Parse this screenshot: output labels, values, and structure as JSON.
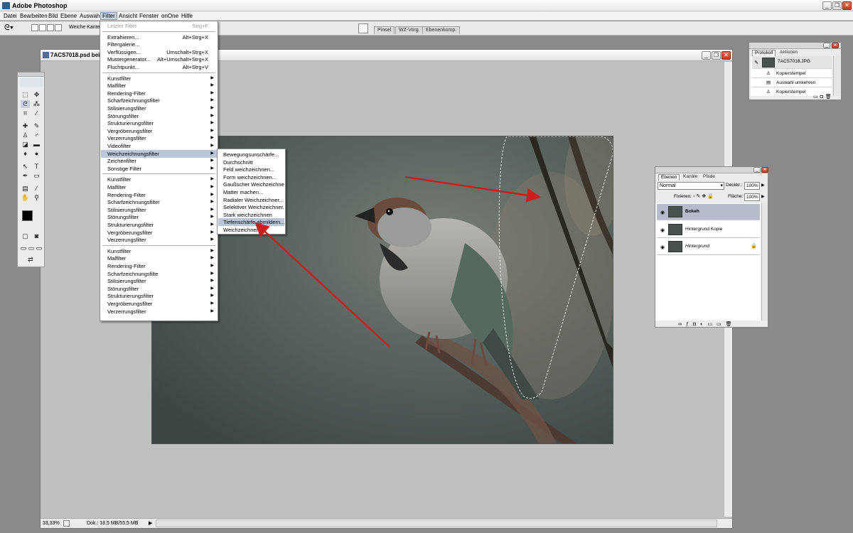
{
  "app": {
    "title": "Adobe Photoshop"
  },
  "menubar": {
    "items": [
      "Datei",
      "Bearbeiten",
      "Bild",
      "Ebene",
      "Auswahl",
      "Filter",
      "Ansicht",
      "Fenster",
      "onOne",
      "Hilfe"
    ],
    "active": "Filter"
  },
  "options_bar": {
    "feather_label": "Weiche Kante:",
    "palette_well_tabs": [
      "Pinsel",
      "WZ-Vorg.",
      "Ebenenkomp."
    ]
  },
  "document": {
    "title": "7ACS7018.psd bei",
    "zoom": "33,33%",
    "doc_info": "Dok.: 18,5 MB/55,5 MB"
  },
  "filter_menu": {
    "items": [
      {
        "label": "Letzter Filter",
        "shortcut": "Strg+F",
        "disabled": true
      },
      {
        "sep": true
      },
      {
        "label": "Extrahieren...",
        "shortcut": "Alt+Strg+X"
      },
      {
        "label": "Filtergalerie..."
      },
      {
        "label": "Verflüssigen...",
        "shortcut": "Umschalt+Strg+X"
      },
      {
        "label": "Mustergenerator...",
        "shortcut": "Alt+Umschalt+Strg+X"
      },
      {
        "label": "Fluchtpunkt...",
        "shortcut": "Alt+Strg+V"
      },
      {
        "sep": true
      },
      {
        "label": "Kunstfilter",
        "sub": true
      },
      {
        "label": "Malfilter",
        "sub": true
      },
      {
        "label": "Rendering-Filter",
        "sub": true
      },
      {
        "label": "Scharfzeichnungsfilter",
        "sub": true
      },
      {
        "label": "Stilisierungsfilter",
        "sub": true
      },
      {
        "label": "Störungsfilter",
        "sub": true
      },
      {
        "label": "Strukturierungsfilter",
        "sub": true
      },
      {
        "label": "Vergröberungsfilter",
        "sub": true
      },
      {
        "label": "Verzerrungsfilter",
        "sub": true
      },
      {
        "label": "Videofilter",
        "sub": true
      },
      {
        "label": "Weichzeichnungsfilter",
        "sub": true,
        "highlight": true
      },
      {
        "label": "Zeichenfilter",
        "sub": true
      },
      {
        "label": "Sonstige Filter",
        "sub": true
      },
      {
        "sep": true
      },
      {
        "label": "Kunstfilter",
        "sub": true
      },
      {
        "label": "Malfilter",
        "sub": true
      },
      {
        "label": "Rendering-Filter",
        "sub": true
      },
      {
        "label": "Scharfzeichnungsfilter",
        "sub": true
      },
      {
        "label": "Stilisierungsfilter",
        "sub": true
      },
      {
        "label": "Störungsfilter",
        "sub": true
      },
      {
        "label": "Strukturierungsfilter",
        "sub": true
      },
      {
        "label": "Vergröberungsfilter",
        "sub": true
      },
      {
        "label": "Verzerrungsfilter",
        "sub": true
      },
      {
        "sep": true
      },
      {
        "label": "Kunstfilter",
        "sub": true
      },
      {
        "label": "Malfilter",
        "sub": true
      },
      {
        "label": "Rendering-Filter",
        "sub": true
      },
      {
        "label": "Scharfzeichnungsfilte",
        "sub": true
      },
      {
        "label": "Stilisierungsfilter",
        "sub": true
      },
      {
        "label": "Störungsfilter",
        "sub": true
      },
      {
        "label": "Strukturierungsfilter",
        "sub": true
      },
      {
        "label": "Vergröberungsfilter",
        "sub": true
      },
      {
        "label": "Verzerrungsfilter",
        "sub": true
      }
    ]
  },
  "blur_submenu": {
    "items": [
      "Bewegungsunschärfe...",
      "Durchschnitt",
      "Feld weichzeichnen...",
      "Form weichzeichnen...",
      "Gaußscher Weichzeichner...",
      "Matter machen...",
      "Radialer Weichzeichner...",
      "Selektiver Weichzeichner...",
      "Stark weichzeichnen",
      "Tiefenschärfe abmildern...",
      "Weichzeichnen"
    ],
    "highlighted": "Tiefenschärfe abmildern..."
  },
  "history_panel": {
    "tabs": [
      "Protokoll",
      "Aktionen"
    ],
    "snapshot": "7ACS7018.JPG",
    "steps": [
      "Kopierstempel",
      "Auswahl umkehren",
      "Kopierstempel"
    ]
  },
  "layers_panel": {
    "tabs": [
      "Ebenen",
      "Kanäle",
      "Pfade"
    ],
    "blend_mode": "Normal",
    "opacity_label": "Deckkr.:",
    "opacity": "100%",
    "lock_label": "Fixieren:",
    "fill_label": "Fläche:",
    "fill": "100%",
    "layers": [
      {
        "name": "Bokeh",
        "selected": true
      },
      {
        "name": "Hintergrund Kopie"
      },
      {
        "name": "Hintergrund",
        "locked": true
      }
    ]
  },
  "colors": {
    "accent": "#cc1c1c",
    "menu_highlight": "#bac6d9"
  }
}
